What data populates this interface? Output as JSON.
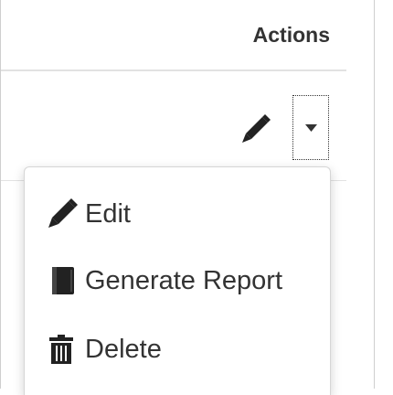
{
  "table": {
    "header": {
      "actions_label": "Actions"
    }
  },
  "row_actions": {
    "edit_icon": "pencil-icon",
    "dropdown_icon": "caret-down-icon"
  },
  "dropdown_menu": {
    "items": [
      {
        "label": "Edit",
        "icon": "pencil-icon"
      },
      {
        "label": "Generate Report",
        "icon": "book-icon"
      },
      {
        "label": "Delete",
        "icon": "trash-icon"
      }
    ]
  },
  "colors": {
    "text": "#333333",
    "border": "#cfcfcf",
    "divider": "#e2e2e2",
    "background": "#ffffff"
  }
}
